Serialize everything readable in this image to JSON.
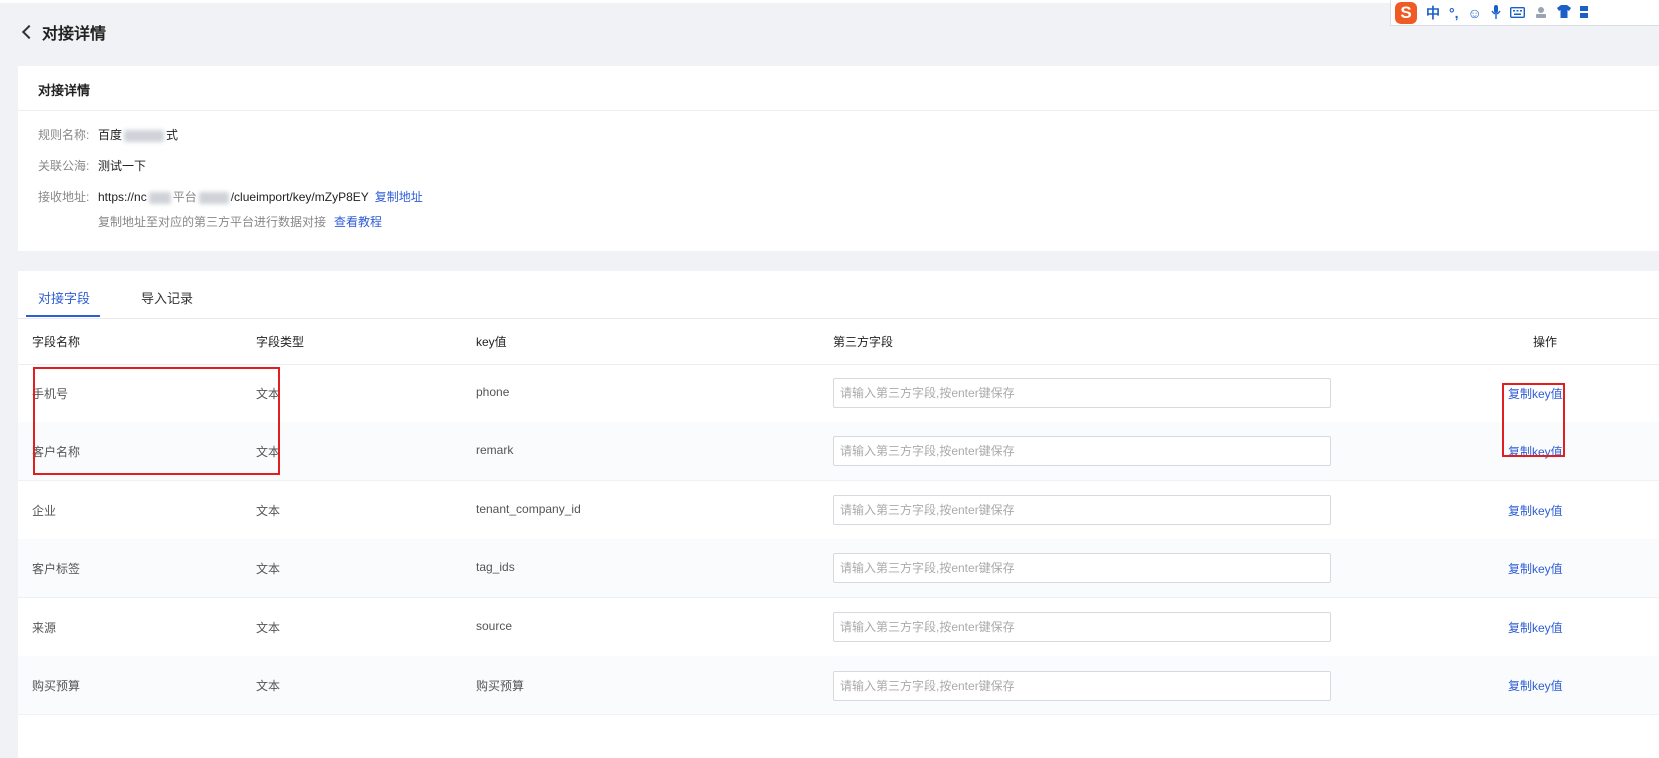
{
  "header": {
    "title": "对接详情"
  },
  "ime": {
    "lang": "中",
    "punct": "°,",
    "smile": "☺",
    "mic": "🎤",
    "keyboard": "⌨"
  },
  "detail": {
    "title": "对接详情",
    "rule_label": "规则名称:",
    "rule_value_start": "百度",
    "rule_value_end": "式",
    "pool_label": "关联公海:",
    "pool_value": "测试一下",
    "url_label": "接收地址:",
    "url_start": "https://nc",
    "url_mid": "平台",
    "url_end": "/clueimport/key/mZyP8EY",
    "copy_url": "复制地址",
    "hint": "复制地址至对应的第三方平台进行数据对接",
    "tutorial": "查看教程"
  },
  "tabs": [
    {
      "label": "对接字段"
    },
    {
      "label": "导入记录"
    }
  ],
  "table": {
    "headers": {
      "name": "字段名称",
      "type": "字段类型",
      "key": "key值",
      "third": "第三方字段",
      "op": "操作"
    },
    "placeholder": "请输入第三方字段,按enter键保存",
    "rows": [
      {
        "name": "手机号",
        "type": "文本",
        "key": "phone",
        "op": "复制key值"
      },
      {
        "name": "客户名称",
        "type": "文本",
        "key": "remark",
        "op": "复制key值"
      },
      {
        "name": "企业",
        "type": "文本",
        "key": "tenant_company_id",
        "op": "复制key值"
      },
      {
        "name": "客户标签",
        "type": "文本",
        "key": "tag_ids",
        "op": "复制key值"
      },
      {
        "name": "来源",
        "type": "文本",
        "key": "source",
        "op": "复制key值"
      },
      {
        "name": "购买预算",
        "type": "文本",
        "key": "购买预算",
        "op": "复制key值"
      }
    ]
  }
}
